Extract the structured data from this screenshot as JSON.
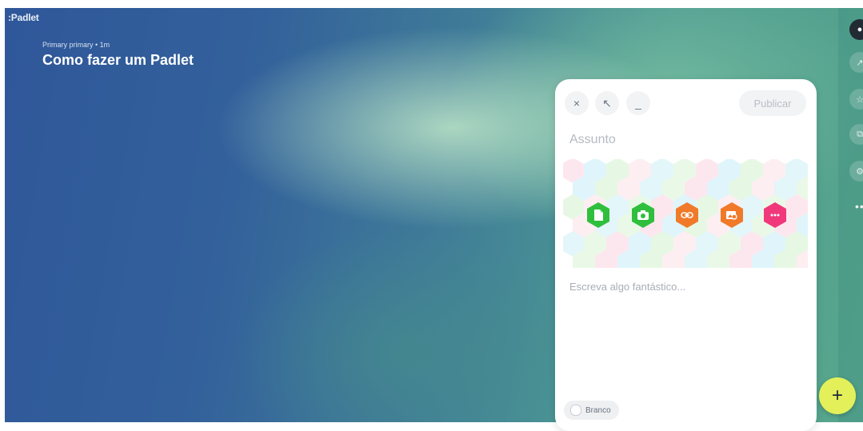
{
  "board": {
    "logo": ":Padlet",
    "author_line": "Primary primary • 1m",
    "title": "Como fazer um Padlet"
  },
  "composer": {
    "close_icon": "×",
    "expand_icon": "↖",
    "minimize_icon": "_",
    "publish_label": "Publicar",
    "subject_placeholder": "Assunto",
    "body_placeholder": "Escreva algo fantástico...",
    "color_label": "Branco",
    "attachments": [
      {
        "name": "upload-file-icon",
        "color": "#2fbf3d"
      },
      {
        "name": "camera-icon",
        "color": "#2fbf3d"
      },
      {
        "name": "link-icon",
        "color": "#f07a2a"
      },
      {
        "name": "image-search-icon",
        "color": "#f07a2a"
      },
      {
        "name": "more-options-icon",
        "color": "#f0387a"
      }
    ]
  },
  "fab": {
    "label": "+"
  },
  "colors": {
    "accent_fab": "#e3f05a",
    "publish_disabled_text": "#b8bec6"
  }
}
